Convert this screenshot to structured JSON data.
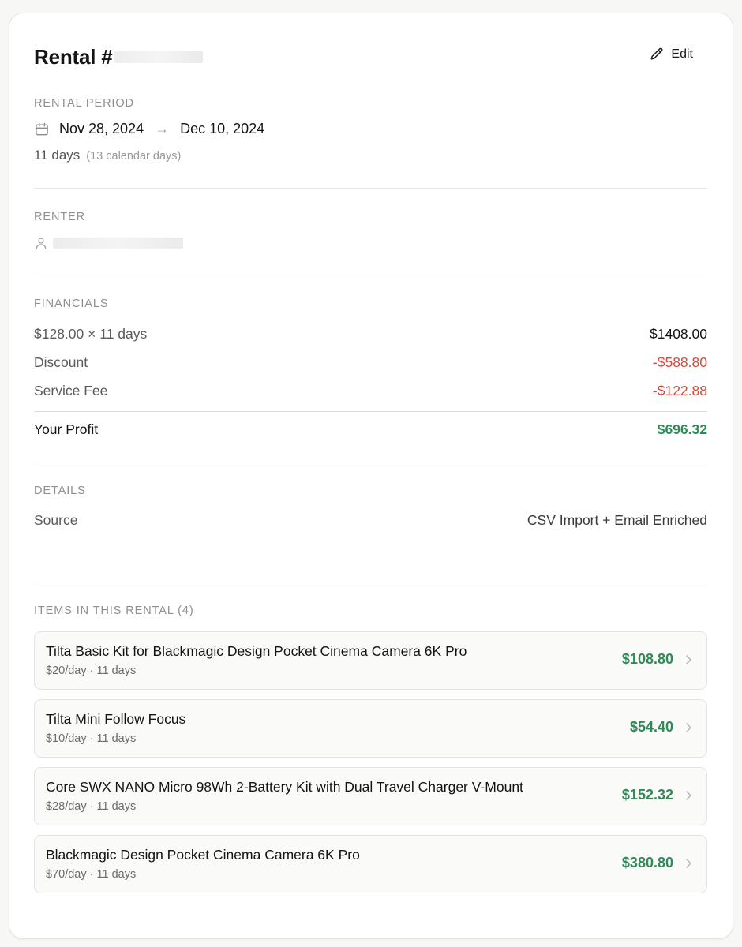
{
  "header": {
    "title": "Rental #",
    "edit_label": "Edit"
  },
  "rental_period": {
    "label": "RENTAL PERIOD",
    "start": "Nov 28, 2024",
    "arrow": "→",
    "end": "Dec 10, 2024",
    "days": "11 days",
    "calendar_days": "(13 calendar days)"
  },
  "renter": {
    "label": "RENTER"
  },
  "financials": {
    "label": "FINANCIALS",
    "rows": [
      {
        "label": "$128.00 × 11 days",
        "value": "$1408.00"
      },
      {
        "label": "Discount",
        "value": "-$588.80"
      },
      {
        "label": "Service Fee",
        "value": "-$122.88"
      }
    ],
    "profit_label": "Your Profit",
    "profit_value": "$696.32"
  },
  "details": {
    "label": "DETAILS",
    "source_label": "Source",
    "source_value": "CSV Import + Email Enriched"
  },
  "items": {
    "label": "ITEMS IN THIS RENTAL (4)",
    "list": [
      {
        "name": "Tilta Basic Kit for Blackmagic Design Pocket Cinema Camera 6K Pro",
        "sub": "$20/day · 11 days",
        "price": "$108.80"
      },
      {
        "name": "Tilta Mini Follow Focus",
        "sub": "$10/day · 11 days",
        "price": "$54.40"
      },
      {
        "name": "Core SWX NANO Micro 98Wh 2-Battery Kit with Dual Travel Charger V-Mount",
        "sub": "$28/day · 11 days",
        "price": "$152.32"
      },
      {
        "name": "Blackmagic Design Pocket Cinema Camera 6K Pro",
        "sub": "$70/day · 11 days",
        "price": "$380.80"
      }
    ]
  },
  "colors": {
    "positive": "#2f8a57",
    "negative": "#d5483b",
    "muted": "#8f8f8f"
  },
  "icons": {
    "edit": "pencil-icon",
    "period": "calendar-icon",
    "renter": "user-icon",
    "item": "chevron-right-icon"
  }
}
